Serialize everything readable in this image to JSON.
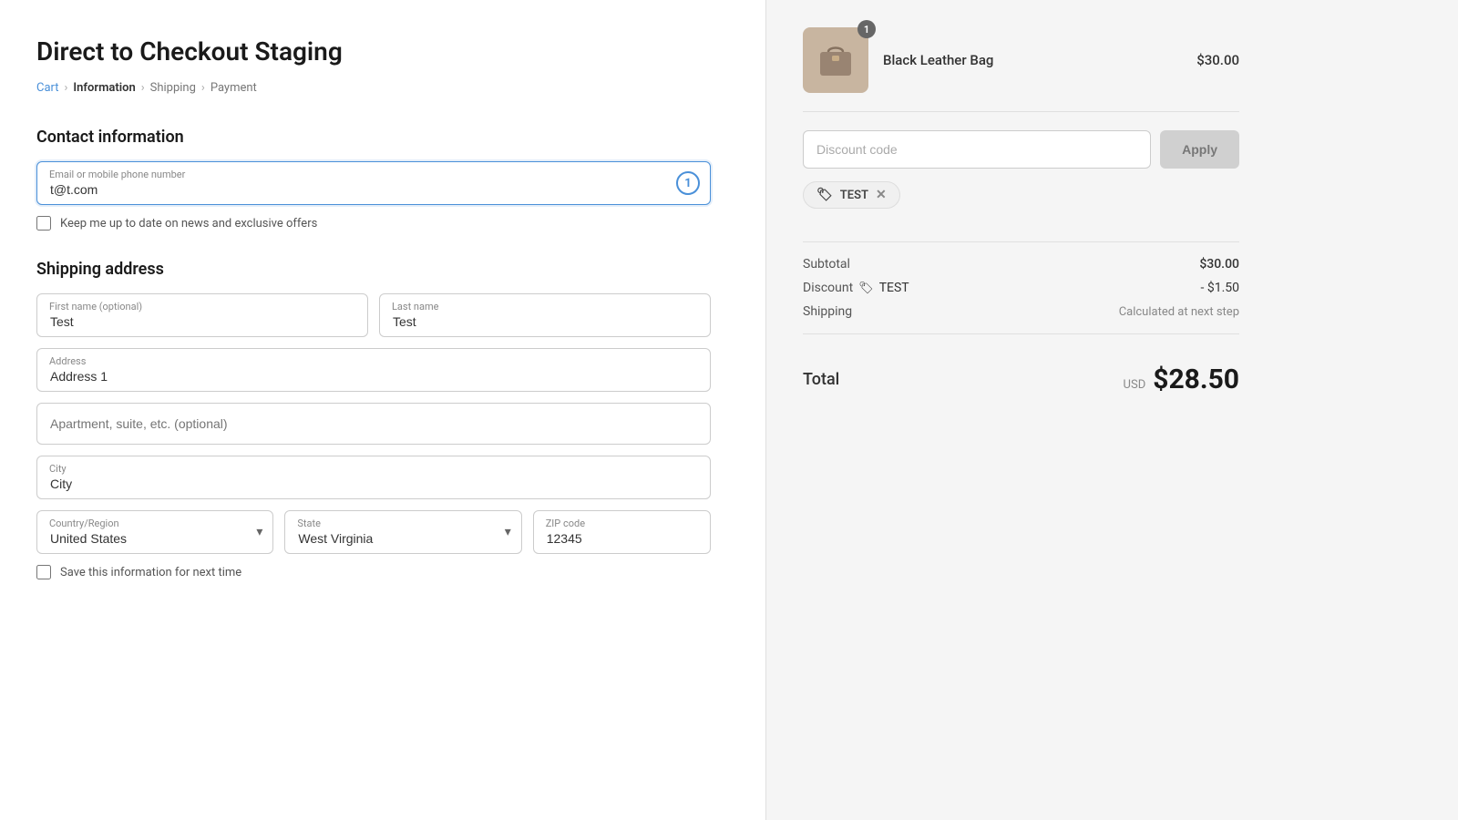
{
  "page": {
    "title": "Direct to Checkout Staging"
  },
  "breadcrumb": {
    "cart": "Cart",
    "information": "Information",
    "shipping": "Shipping",
    "payment": "Payment"
  },
  "contact": {
    "section_title": "Contact information",
    "email_label": "Email or mobile phone number",
    "email_value": "t@t.com",
    "newsletter_label": "Keep me up to date on news and exclusive offers"
  },
  "shipping": {
    "section_title": "Shipping address",
    "first_name_label": "First name (optional)",
    "first_name_value": "Test",
    "last_name_label": "Last name",
    "last_name_value": "Test",
    "address_label": "Address",
    "address_value": "Address 1",
    "apt_placeholder": "Apartment, suite, etc. (optional)",
    "city_label": "City",
    "city_value": "City",
    "country_label": "Country/Region",
    "country_value": "United States",
    "state_label": "State",
    "state_value": "West Virginia",
    "zip_label": "ZIP code",
    "zip_value": "12345",
    "save_label": "Save this information for next time"
  },
  "order_summary": {
    "product_name": "Black Leather Bag",
    "product_price": "$30.00",
    "product_badge": "1",
    "discount_placeholder": "Discount code",
    "apply_label": "Apply",
    "discount_tag": "TEST",
    "subtotal_label": "Subtotal",
    "subtotal_value": "$30.00",
    "discount_label": "Discount",
    "discount_code": "TEST",
    "discount_value": "- $1.50",
    "shipping_label": "Shipping",
    "shipping_value": "Calculated at next step",
    "total_label": "Total",
    "total_currency": "USD",
    "total_amount": "$28.50"
  }
}
